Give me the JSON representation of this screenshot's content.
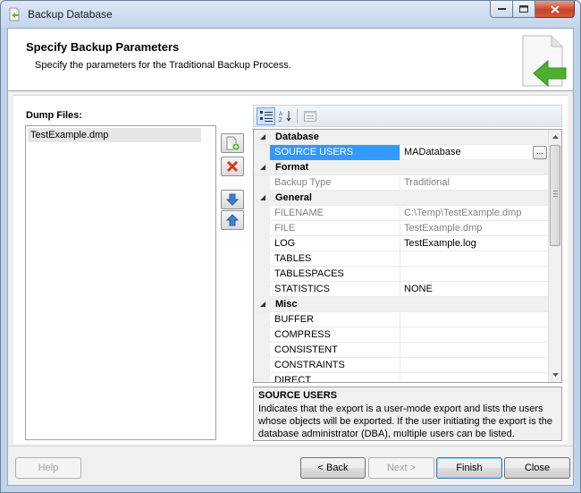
{
  "window": {
    "title": "Backup Database"
  },
  "header": {
    "title": "Specify Backup Parameters",
    "subtitle": "Specify the parameters for the Traditional Backup Process."
  },
  "dump_files": {
    "label": "Dump Files:",
    "items": [
      "TestExample.dmp"
    ]
  },
  "property_grid": {
    "rows": [
      {
        "type": "category",
        "name": "Database"
      },
      {
        "type": "prop",
        "name": "SOURCE USERS",
        "value": "MADatabase",
        "selected": true,
        "has_ellipsis": true,
        "ellipsis_label": "..."
      },
      {
        "type": "category",
        "name": "Format"
      },
      {
        "type": "prop",
        "name": "Backup Type",
        "value": "Traditional",
        "dim": true
      },
      {
        "type": "category",
        "name": "General"
      },
      {
        "type": "prop",
        "name": "FILENAME",
        "value": "C:\\Temp\\TestExample.dmp",
        "dim": true
      },
      {
        "type": "prop",
        "name": "FILE",
        "value": "TestExample.dmp",
        "dim": true
      },
      {
        "type": "prop",
        "name": "LOG",
        "value": "TestExample.log"
      },
      {
        "type": "prop",
        "name": "TABLES",
        "value": ""
      },
      {
        "type": "prop",
        "name": "TABLESPACES",
        "value": ""
      },
      {
        "type": "prop",
        "name": "STATISTICS",
        "value": "NONE"
      },
      {
        "type": "category",
        "name": "Misc"
      },
      {
        "type": "prop",
        "name": "BUFFER",
        "value": ""
      },
      {
        "type": "prop",
        "name": "COMPRESS",
        "value": ""
      },
      {
        "type": "prop",
        "name": "CONSISTENT",
        "value": ""
      },
      {
        "type": "prop",
        "name": "CONSTRAINTS",
        "value": ""
      },
      {
        "type": "prop",
        "name": "DIRECT",
        "value": ""
      }
    ]
  },
  "description": {
    "title": "SOURCE USERS",
    "text": "Indicates that the export is a user-mode export and lists the users whose objects will be exported. If the user initiating the export is the database administrator (DBA), multiple users can be listed."
  },
  "buttons": {
    "help": "Help",
    "back": "< Back",
    "next": "Next >",
    "finish": "Finish",
    "close": "Close"
  }
}
